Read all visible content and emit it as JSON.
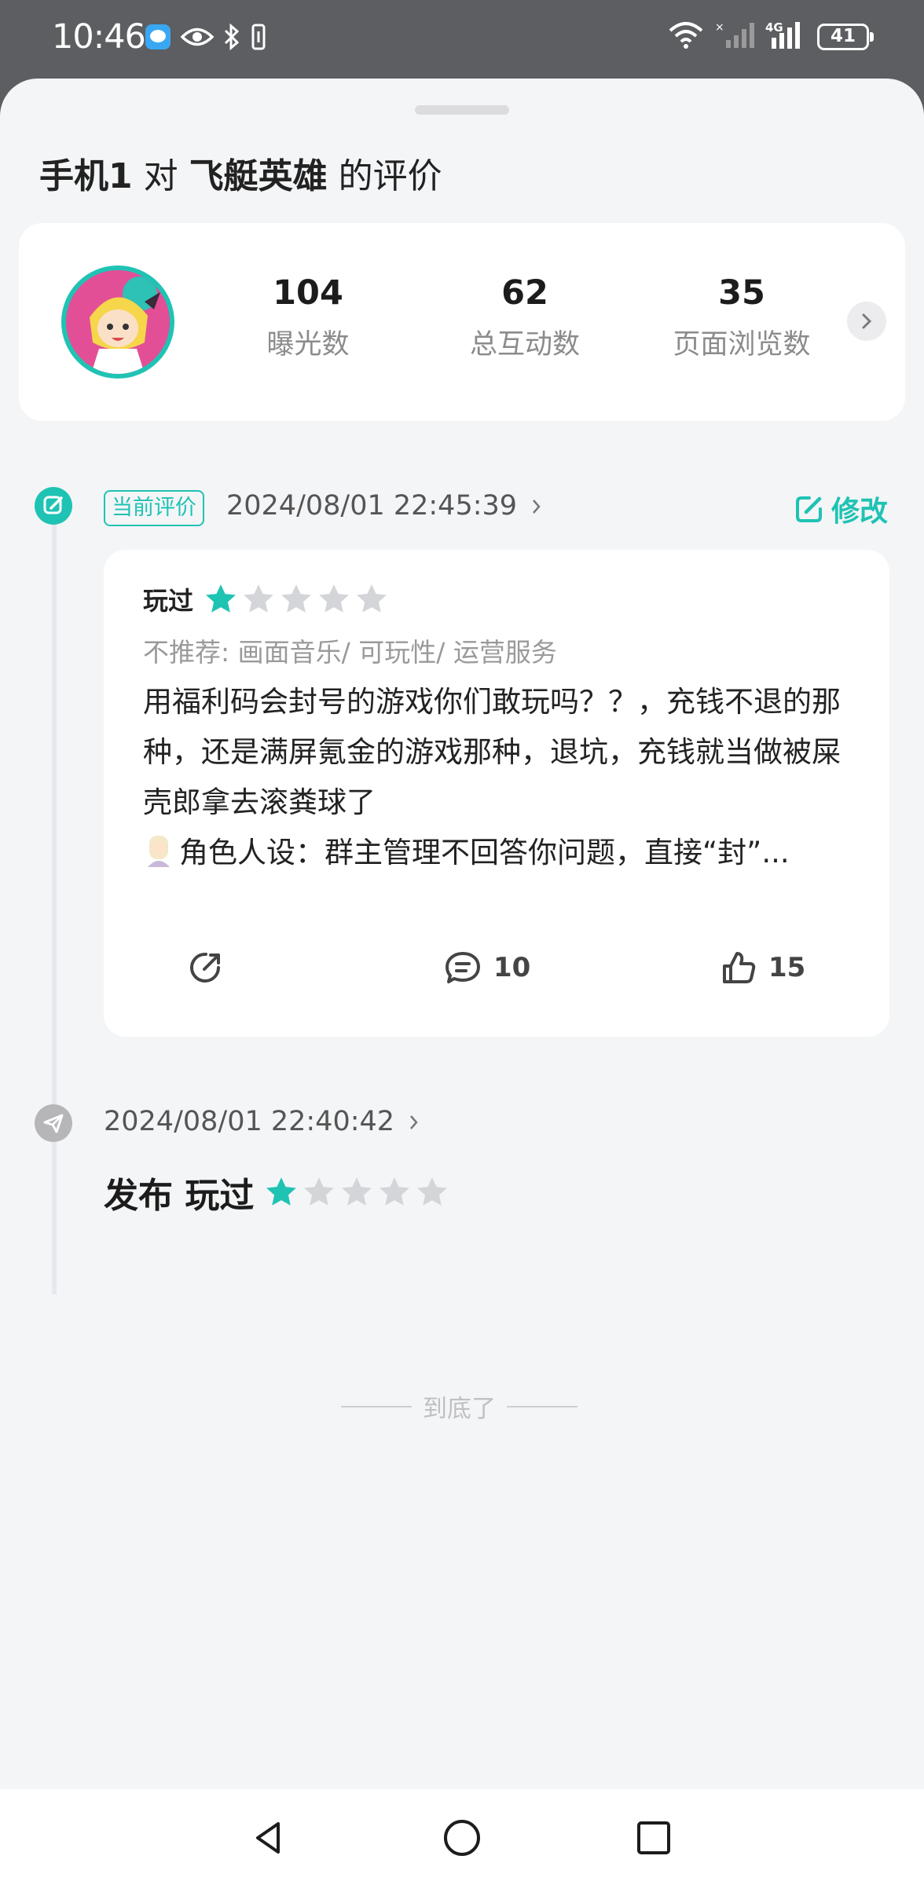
{
  "status_bar": {
    "time": "10:46",
    "battery": "41",
    "network": "4G",
    "icons": [
      "chat-bubble-icon",
      "eye-icon",
      "bluetooth-icon",
      "vibrate-icon",
      "wifi-icon",
      "signal-icon",
      "battery-icon"
    ]
  },
  "header": {
    "user": "手机1",
    "connector": "对",
    "game": "飞艇英雄",
    "suffix": "的评价"
  },
  "stats": [
    {
      "value": "104",
      "label": "曝光数"
    },
    {
      "value": "62",
      "label": "总互动数"
    },
    {
      "value": "35",
      "label": "页面浏览数"
    }
  ],
  "timeline": {
    "current": {
      "badge": "当前评价",
      "datetime": "2024/08/01 22:45:39",
      "edit_label": "修改",
      "review": {
        "status": "玩过",
        "rating": 1,
        "max_rating": 5,
        "tags": "不推荐: 画面音乐/ 可玩性/ 运营服务",
        "text_line1": "用福利码会封号的游戏你们敢玩吗？？，充钱不退的那种，还是满屏氪金的游戏那种，退坑，充钱就当做被屎壳郎拿去滚粪球了",
        "text_line2": "角色人设：群主管理不回答你问题，直接“封”...",
        "comments": "10",
        "likes": "15"
      }
    },
    "initial": {
      "datetime": "2024/08/01 22:40:42",
      "action": "发布 玩过",
      "rating": 1,
      "max_rating": 5
    }
  },
  "footer_text": "到底了",
  "colors": {
    "accent": "#1fc3b4",
    "star_empty": "#d4d5d9",
    "background": "#f4f5f7",
    "status_bar": "#5d5e61"
  }
}
